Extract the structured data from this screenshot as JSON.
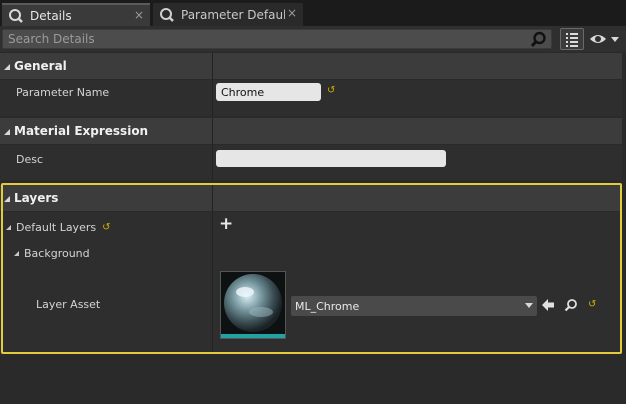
{
  "tabs": [
    {
      "label": "Details",
      "close": "×"
    },
    {
      "label": "Parameter Defaults",
      "close": "×"
    }
  ],
  "search": {
    "placeholder": "Search Details"
  },
  "categories": {
    "general": {
      "title": "General",
      "rows": {
        "parameter_name": {
          "label": "Parameter Name",
          "value": "Chrome",
          "reset": "↺"
        }
      }
    },
    "material_expression": {
      "title": "Material Expression",
      "rows": {
        "desc": {
          "label": "Desc",
          "value": ""
        }
      }
    },
    "layers": {
      "title": "Layers",
      "default_layers": {
        "label": "Default Layers",
        "reset": "↺",
        "add": "+"
      },
      "background": {
        "label": "Background"
      },
      "layer_asset": {
        "label": "Layer Asset",
        "value": "ML_Chrome",
        "reset": "↺"
      }
    }
  },
  "colors": {
    "highlight": "#e3cc3b",
    "reset_arrow": "#d2b000"
  }
}
